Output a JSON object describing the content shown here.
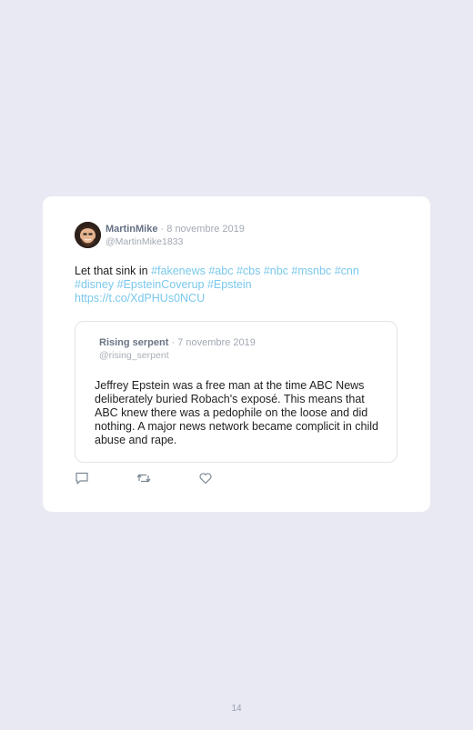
{
  "tweet": {
    "author_name": "MartinMike",
    "separator": "·",
    "date": "8 novembre 2019",
    "handle": "@MartinMike1833",
    "text_plain": "Let that sink in",
    "hashtags": [
      "#fakenews",
      "#abc",
      "#cbs",
      "#nbc",
      "#msnbc",
      "#cnn",
      "#disney",
      "#EpsteinCoverup",
      "#Epstein"
    ],
    "link": "https://t.co/XdPHUs0NCU"
  },
  "quote": {
    "author_name": "Rising serpent",
    "separator": "·",
    "date": "7 novembre 2019",
    "handle": "@rising_serpent",
    "text": "Jeffrey Epstein was a free man at the time ABC News deliberately buried Robach's exposé. This means that ABC knew there was a pedophile on the loose and did nothing. A major news network became complicit in child abuse and rape."
  },
  "actions": [
    {
      "name": "reply",
      "icon": "comment-icon"
    },
    {
      "name": "retweet",
      "icon": "retweet-icon"
    },
    {
      "name": "like",
      "icon": "heart-icon"
    }
  ],
  "page_number": "14",
  "colors": {
    "background": "#e9e9f3",
    "card": "#ffffff",
    "hashtag": "#7ac8ec",
    "muted": "#a2a8b3"
  }
}
